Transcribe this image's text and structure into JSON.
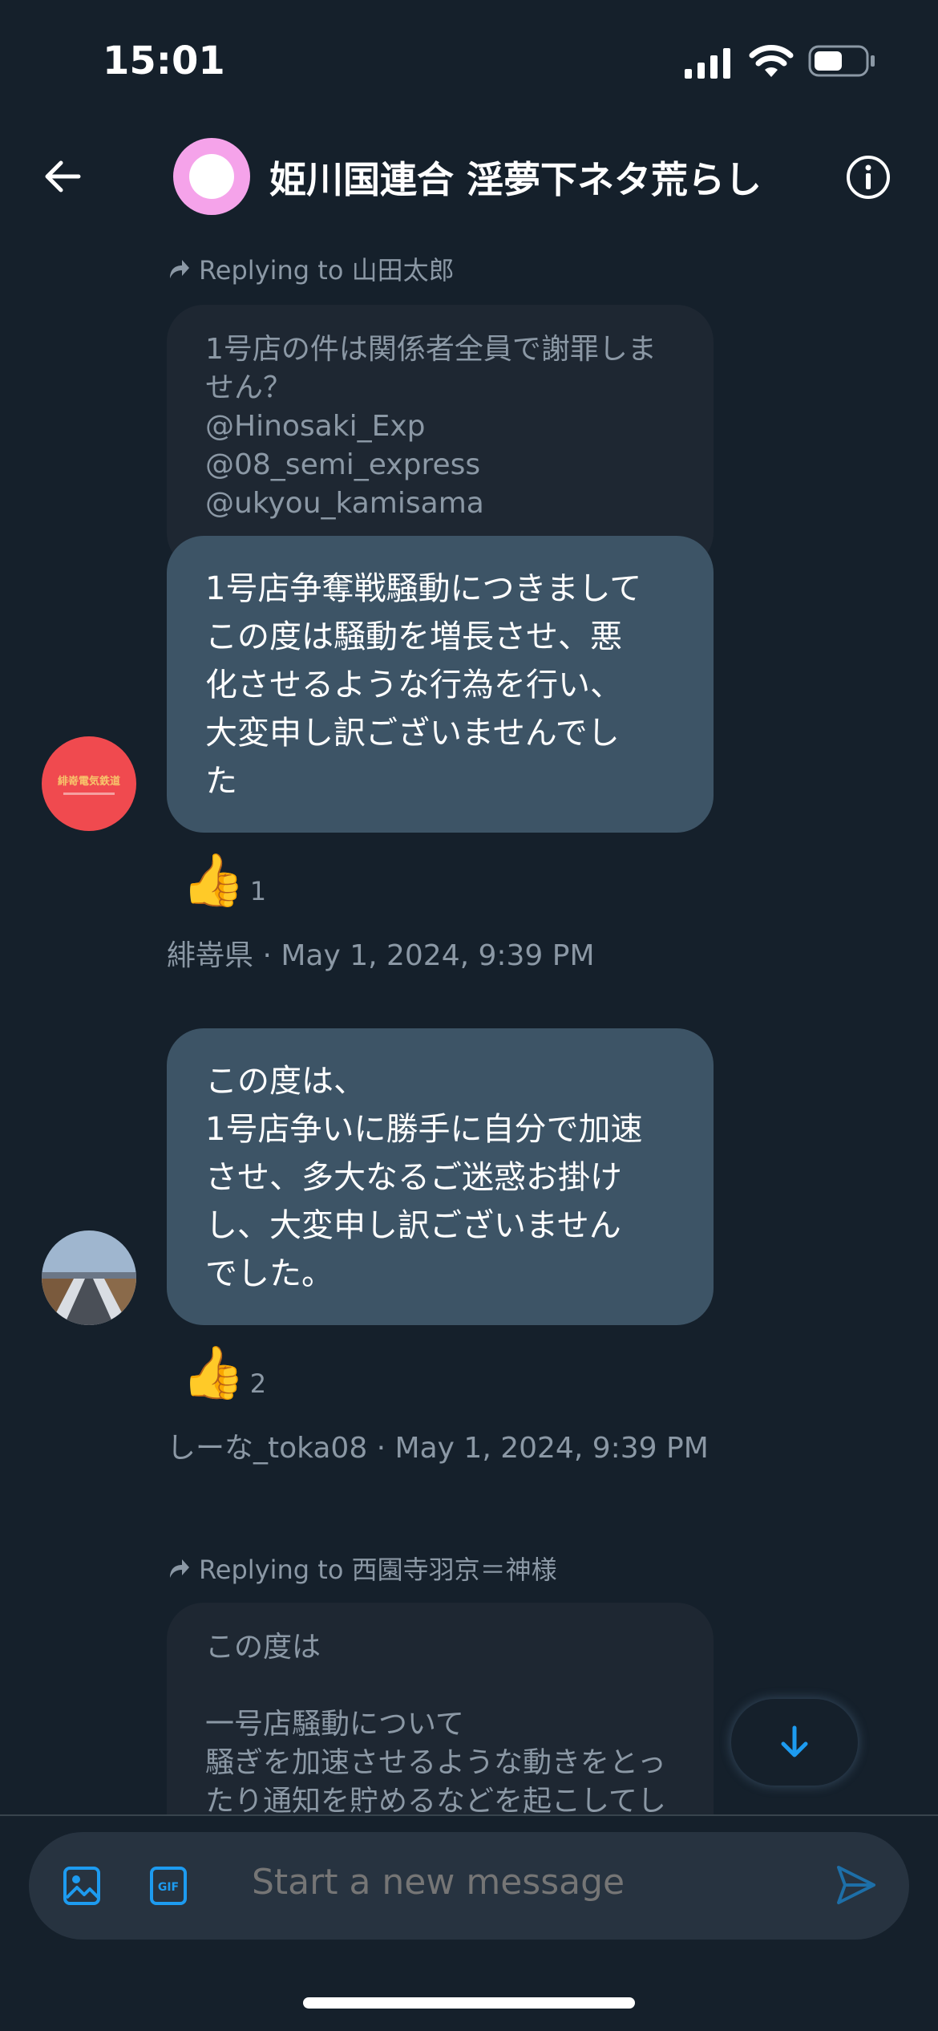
{
  "status_bar": {
    "time": "15:01"
  },
  "header": {
    "title": "姫川国連合 淫夢下ネタ荒らし"
  },
  "messages": [
    {
      "reply_to": "Replying to 山田太郎",
      "quote": "1号店の件は関係者全員で謝罪しま\nせん？\n@Hinosaki_Exp\n@08_semi_express\n@ukyou_kamisama",
      "text": "1号店争奪戦騒動につきまして\nこの度は騒動を増長させ、悪\n化させるような行為を行い、\n大変申し訳ございませんでし\nた",
      "reaction_count": "1",
      "meta": "緋嵜県 · May 1, 2024, 9:39 PM",
      "avatar": {
        "color": "#f04a4f",
        "text": "緋嵜電気鉄道"
      }
    },
    {
      "text": "この度は、\n1号店争いに勝手に自分で加速\nさせ、多大なるご迷惑お掛け\nし、大変申し訳ございません\nでした。",
      "reaction_count": "2",
      "meta": "しーな_toka08 · May 1, 2024, 9:39 PM"
    },
    {
      "reply_to": "Replying to 西園寺羽京＝神様",
      "quote": "この度は\n\n一号店騒動について\n騒ぎを加速させるような動きをとっ\nたり通知を貯めるなどを起こしてし"
    }
  ],
  "composer": {
    "placeholder": "Start a new message"
  },
  "colors": {
    "accent": "#1d9bf0",
    "bubble": "#3d5466",
    "background": "#15202b"
  }
}
